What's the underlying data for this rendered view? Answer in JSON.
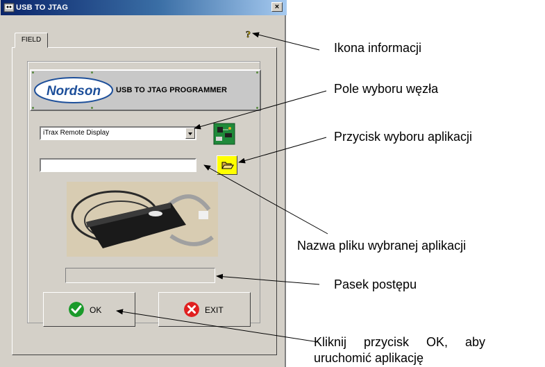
{
  "window": {
    "title": "USB TO JTAG",
    "close_glyph": "×"
  },
  "tab": {
    "label": "FIELD"
  },
  "banner": {
    "logo_text": "Nordson",
    "text": "USB TO JTAG PROGRAMMER"
  },
  "node_select": {
    "value": "iTrax Remote Display"
  },
  "file_input": {
    "value": ""
  },
  "progress": {
    "value": 0
  },
  "buttons": {
    "ok_label": "OK",
    "exit_label": "EXIT"
  },
  "annotations": {
    "info_icon": "Ikona informacji",
    "node_select": "Pole wyboru węzła",
    "app_button": "Przycisk wyboru aplikacji",
    "file_name": "Nazwa pliku wybranej aplikacji",
    "progress_bar": "Pasek postępu",
    "ok_line1": "Kliknij     przycisk     OK,     aby",
    "ok_line2": "uruchomić aplikację"
  },
  "icons": {
    "help": "help-question-icon",
    "board": "circuit-board-icon",
    "folder": "open-folder-icon",
    "ok": "green-check-icon",
    "exit": "red-x-icon"
  },
  "colors": {
    "title_bar": "#0a246a",
    "window_bg": "#d4d0c8",
    "folder_button": "#ffff00",
    "ok_icon": "#1a9a2a",
    "exit_icon": "#e02020"
  }
}
